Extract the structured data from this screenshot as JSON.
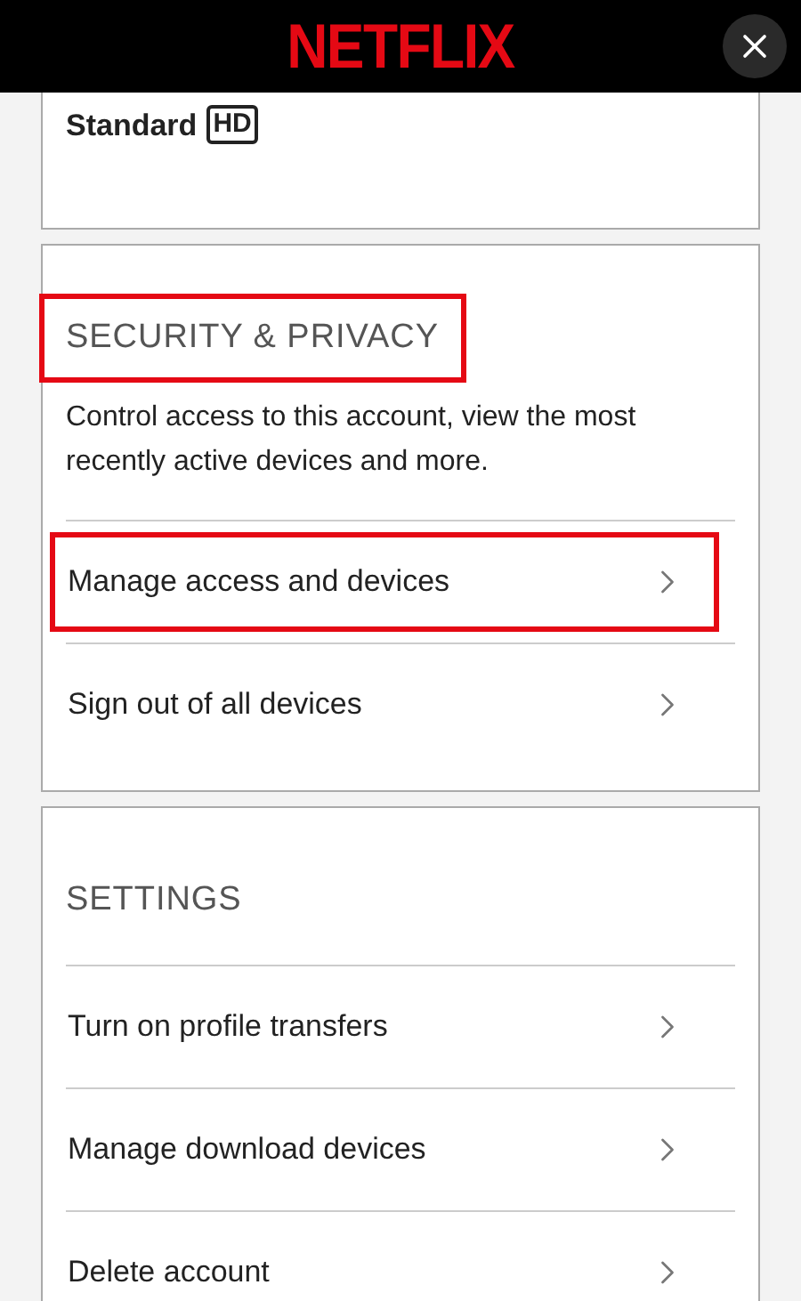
{
  "header": {
    "logo": "NETFLIX"
  },
  "plan": {
    "name": "Standard",
    "badge": "HD"
  },
  "sections": [
    {
      "title": "SECURITY & PRIVACY",
      "highlighted": true,
      "description": "Control access to this account, view the most recently active devices and more.",
      "items": [
        {
          "label": "Manage access and devices",
          "highlighted": true
        },
        {
          "label": "Sign out of all devices",
          "highlighted": false
        }
      ]
    },
    {
      "title": "SETTINGS",
      "highlighted": false,
      "items": [
        {
          "label": "Turn on profile transfers",
          "highlighted": false
        },
        {
          "label": "Manage download devices",
          "highlighted": false
        },
        {
          "label": "Delete account",
          "highlighted": false
        }
      ]
    }
  ]
}
